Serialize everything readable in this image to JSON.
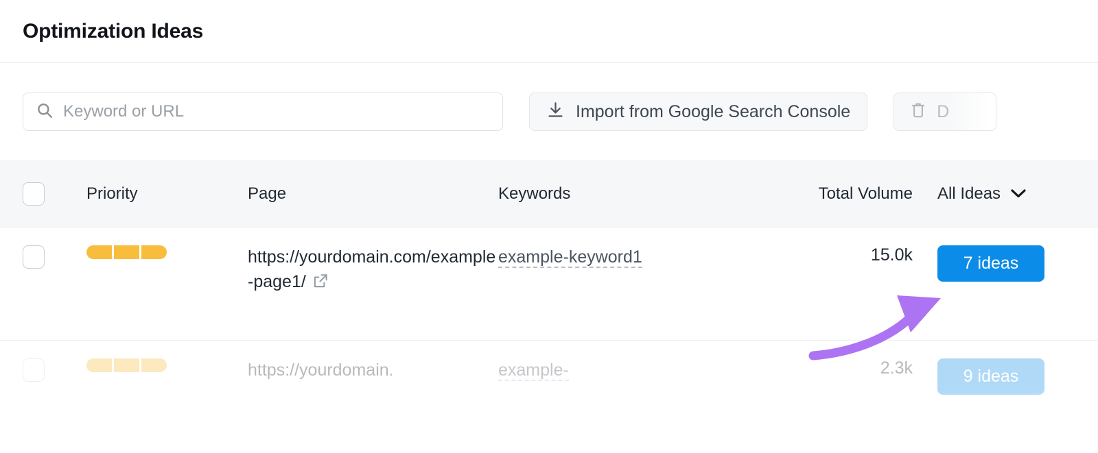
{
  "header": {
    "title": "Optimization Ideas"
  },
  "toolbar": {
    "search": {
      "placeholder": "Keyword or URL",
      "value": "",
      "icon": "search-icon"
    },
    "import_button": {
      "label": "Import from Google Search Console",
      "icon": "download-icon"
    },
    "delete_button": {
      "label": "D",
      "icon": "trash-icon"
    }
  },
  "table": {
    "columns": {
      "priority": "Priority",
      "page": "Page",
      "keywords": "Keywords",
      "total_volume": "Total Volume",
      "ideas_filter": "All Ideas"
    },
    "ideas_filter_icon": "chevron-down-icon",
    "rows": [
      {
        "priority_segments": 3,
        "priority_color": "#f8bd3c",
        "page": "https://yourdomain.com/example-page1/",
        "page_link_icon": "external-link-icon",
        "keyword": "example-keyword1",
        "total_volume": "15.0k",
        "ideas_label": "7 ideas",
        "ideas_color": "#0b8ce8"
      },
      {
        "priority_segments": 3,
        "priority_color": "#f8bd3c",
        "page": "https://yourdomain.",
        "page_link_icon": "external-link-icon",
        "keyword": "example-",
        "total_volume": "2.3k",
        "ideas_label": "9 ideas",
        "ideas_color": "#0b8ce8"
      }
    ]
  },
  "annotation": {
    "type": "curved-arrow",
    "color": "#ac74f2",
    "points_to": "7 ideas"
  }
}
